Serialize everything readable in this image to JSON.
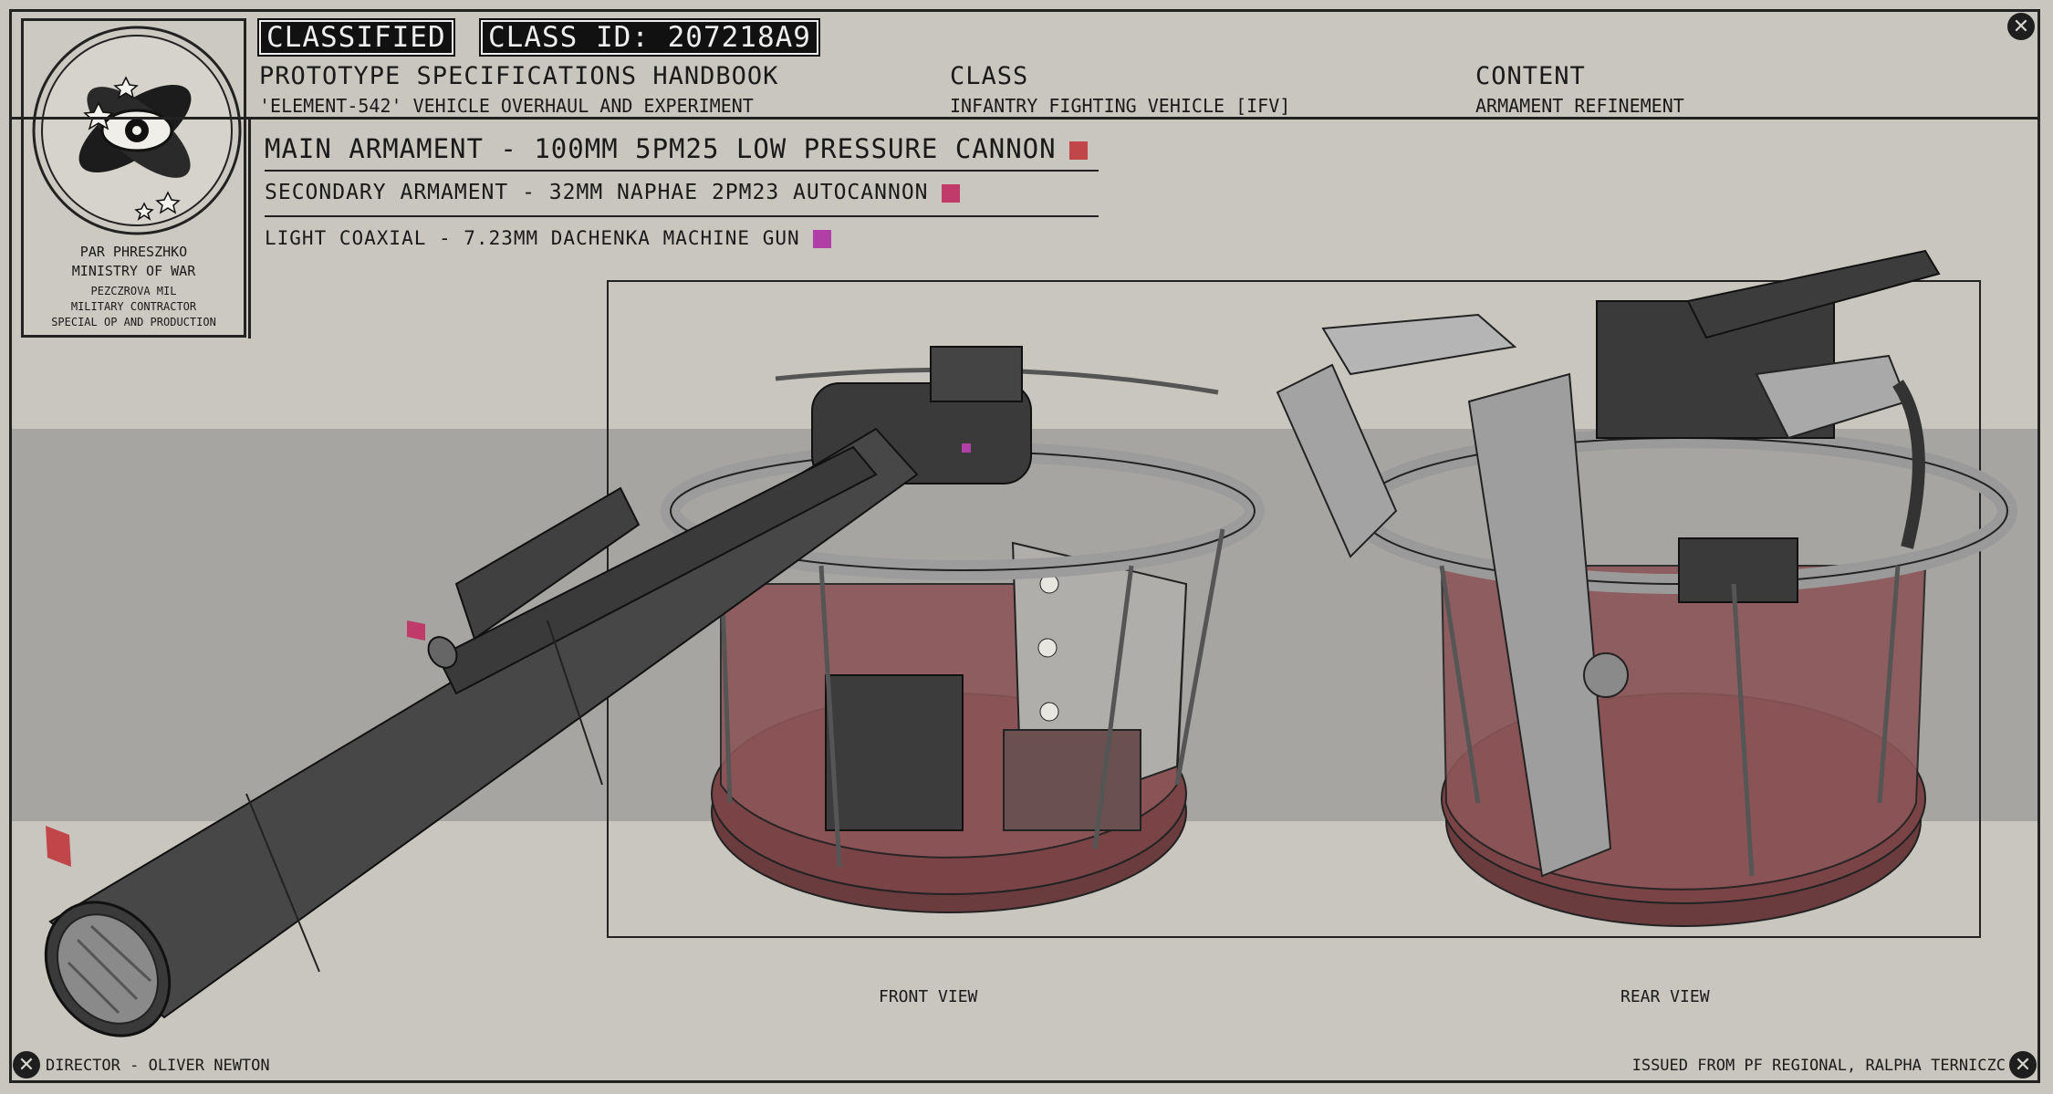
{
  "header": {
    "classified_label": "CLASSIFIED",
    "class_id_label": "CLASS ID: 207218A9",
    "columns": [
      {
        "title": "PROTOTYPE SPECIFICATIONS HANDBOOK",
        "subtitle": "'ELEMENT-542' VEHICLE OVERHAUL AND EXPERIMENT"
      },
      {
        "title": "CLASS",
        "subtitle": "INFANTRY FIGHTING VEHICLE [IFV]"
      },
      {
        "title": "CONTENT",
        "subtitle": "ARMAMENT REFINEMENT"
      }
    ]
  },
  "emblem": {
    "lines": [
      "PAR PHRESZHKO",
      "MINISTRY OF WAR",
      "PEZCZROVA MIL",
      "MILITARY CONTRACTOR",
      "SPECIAL OP AND PRODUCTION"
    ]
  },
  "armaments": [
    {
      "label": "MAIN ARMAMENT - 100MM 5PM25 LOW PRESSURE CANNON",
      "color": "#c0464a"
    },
    {
      "label": "SECONDARY ARMAMENT - 32MM NAPHAE 2PM23 AUTOCANNON",
      "color": "#c03a6a"
    },
    {
      "label": "LIGHT COAXIAL - 7.23MM DACHENKA MACHINE GUN",
      "color": "#b040a8"
    }
  ],
  "views": {
    "front_label": "FRONT VIEW",
    "rear_label": "REAR VIEW"
  },
  "footer": {
    "director": "DIRECTOR - OLIVER NEWTON",
    "issued": "ISSUED FROM PF REGIONAL, RALPHA TERNICZC"
  },
  "icons": {
    "close": "close-icon",
    "emblem": "ministry-emblem"
  },
  "colors": {
    "background": "#c9c6c0",
    "band": "#a7a5a2",
    "turret_metal": "#4a4a4a",
    "turret_light": "#9a9a9a",
    "turret_red": "#7a4446"
  }
}
